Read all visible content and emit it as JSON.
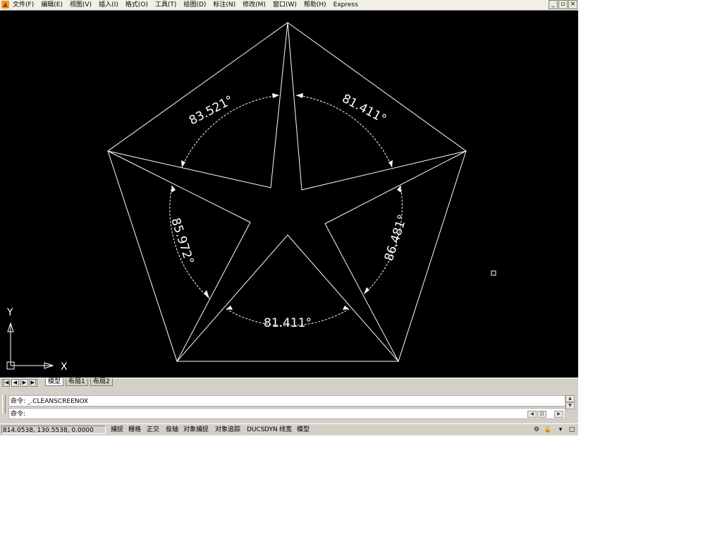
{
  "menu": {
    "items": [
      "文件(F)",
      "编辑(E)",
      "视图(V)",
      "插入(I)",
      "格式(O)",
      "工具(T)",
      "绘图(D)",
      "标注(N)",
      "修改(M)",
      "窗口(W)",
      "帮助(H)",
      "Express"
    ]
  },
  "window_buttons": [
    "_",
    "▫",
    "×"
  ],
  "drawing": {
    "dimensions": {
      "top_left": "83.521°",
      "top_right": "81.411°",
      "left": "85.972°",
      "right": "86.481°",
      "bottom": "81.411°"
    },
    "axis_x": "X",
    "axis_y": "Y"
  },
  "layout_tabs": [
    "模型",
    "布局1",
    "布局2"
  ],
  "command": {
    "previous": "命令: _.CLEANSCREENOX",
    "current": "命令:"
  },
  "status": {
    "coordinates": "814.0538, 130.5538, 0.0000",
    "toggles": [
      "捕捉",
      "栅格",
      "正交",
      "极轴",
      "对象捕捉",
      "对象追踪",
      "DUCS",
      "DYN",
      "线宽",
      "模型"
    ]
  },
  "colors": {
    "canvas": "#000000",
    "lines": "#ffffff",
    "chrome": "#d4d0c8"
  }
}
